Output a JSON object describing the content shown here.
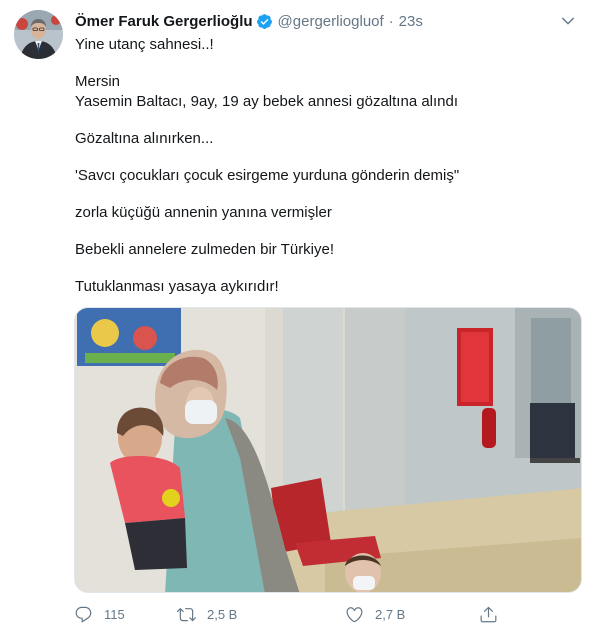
{
  "author": {
    "display_name": "Ömer Faruk Gergerlioğlu",
    "handle": "@gergerliogluof",
    "separator": "·",
    "time": "23s",
    "verified": true
  },
  "tweet": {
    "lines": [
      "Yine utanç sahnesi..!",
      "",
      "Mersin",
      "Yasemin Baltacı, 9ay, 19 ay bebek annesi gözaltına alındı",
      "",
      "Gözaltına alınırken...",
      "",
      "'Savcı çocukları çocuk esirgeme yurduna gönderin demiş\"",
      "",
      "zorla küçüğü annenin yanına vermişler",
      "",
      "Bebekli annelere zulmeden bir Türkiye!",
      "",
      "Tutuklanması yasaya aykırıdır!"
    ]
  },
  "actions": {
    "reply_count": "115",
    "retweet_count": "2,5 B",
    "like_count": "2,7 B"
  },
  "icons": {
    "verified": "verified-badge-icon",
    "more": "chevron-down-icon",
    "reply": "reply-icon",
    "retweet": "retweet-icon",
    "like": "heart-icon",
    "share": "share-icon"
  },
  "colors": {
    "primary_text": "#14171a",
    "secondary_text": "#657786",
    "verified_blue": "#1da1f2"
  }
}
